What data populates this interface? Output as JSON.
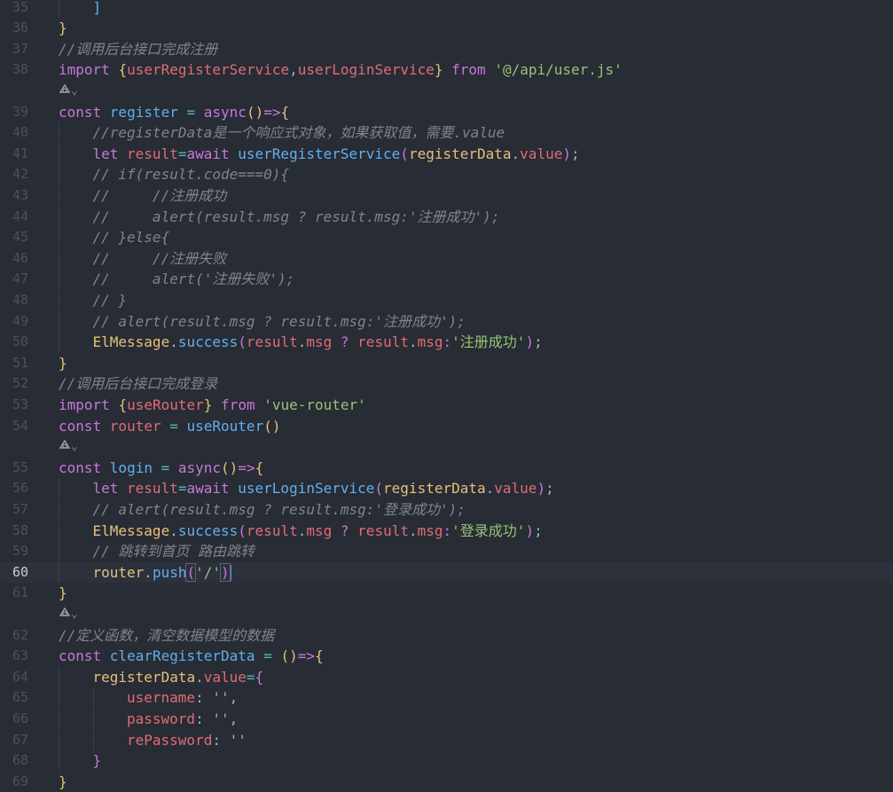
{
  "colors": {
    "background": "#282c34",
    "line_number": "#495162",
    "current_line_number": "#c8ccd4",
    "keyword": "#c678dd",
    "variable": "#e06c75",
    "function": "#61afef",
    "string": "#98c379",
    "comment": "#7f848e",
    "operator": "#56b6c2",
    "punctuation": "#abb2bf",
    "bracket_level1": "#e5c07b",
    "bracket_level2": "#c678dd",
    "bracket_level3": "#61afef"
  },
  "current_line": "60",
  "lines": [
    {
      "kind": "code",
      "num": "35",
      "indent": 1,
      "tokens": [
        {
          "t": "]",
          "c": "b3"
        }
      ]
    },
    {
      "kind": "code",
      "num": "36",
      "indent": 0,
      "tokens": [
        {
          "t": "}",
          "c": "b1"
        }
      ]
    },
    {
      "kind": "code",
      "num": "37",
      "indent": 0,
      "tokens": [
        {
          "t": "//调用后台接口完成注册",
          "c": "cm"
        }
      ]
    },
    {
      "kind": "code",
      "num": "38",
      "indent": 0,
      "tokens": [
        {
          "t": "import ",
          "c": "kw"
        },
        {
          "t": "{",
          "c": "b1"
        },
        {
          "t": "userRegisterService",
          "c": "var"
        },
        {
          "t": ",",
          "c": "pl"
        },
        {
          "t": "userLoginService",
          "c": "var"
        },
        {
          "t": "}",
          "c": "b1"
        },
        {
          "t": " from ",
          "c": "kw"
        },
        {
          "t": "'@/api/user.js'",
          "c": "str"
        }
      ]
    },
    {
      "kind": "lens",
      "icon": "codeium-lens-icon",
      "text": "⌄"
    },
    {
      "kind": "code",
      "num": "39",
      "indent": 0,
      "tokens": [
        {
          "t": "const ",
          "c": "kw"
        },
        {
          "t": "register",
          "c": "fn"
        },
        {
          "t": " = ",
          "c": "op"
        },
        {
          "t": "async",
          "c": "kw"
        },
        {
          "t": "()",
          "c": "b1"
        },
        {
          "t": "=>",
          "c": "kw"
        },
        {
          "t": "{",
          "c": "b1"
        }
      ]
    },
    {
      "kind": "code",
      "num": "40",
      "indent": 1,
      "tokens": [
        {
          "t": "//registerData是一个响应式对象，如果获取值，需要.value",
          "c": "cm"
        }
      ]
    },
    {
      "kind": "code",
      "num": "41",
      "indent": 1,
      "tokens": [
        {
          "t": "let ",
          "c": "kw"
        },
        {
          "t": "result",
          "c": "var"
        },
        {
          "t": "=",
          "c": "op"
        },
        {
          "t": "await ",
          "c": "kw"
        },
        {
          "t": "userRegisterService",
          "c": "fn"
        },
        {
          "t": "(",
          "c": "b2"
        },
        {
          "t": "registerData",
          "c": "obj"
        },
        {
          "t": ".",
          "c": "pl"
        },
        {
          "t": "value",
          "c": "var"
        },
        {
          "t": ")",
          "c": "b2"
        },
        {
          "t": ";",
          "c": "pl"
        }
      ]
    },
    {
      "kind": "code",
      "num": "42",
      "indent": 1,
      "tokens": [
        {
          "t": "// if(result.code===0){",
          "c": "cm"
        }
      ]
    },
    {
      "kind": "code",
      "num": "43",
      "indent": 1,
      "tokens": [
        {
          "t": "//     //注册成功",
          "c": "cm"
        }
      ]
    },
    {
      "kind": "code",
      "num": "44",
      "indent": 1,
      "tokens": [
        {
          "t": "//     alert(result.msg ? result.msg:'注册成功');",
          "c": "cm"
        }
      ]
    },
    {
      "kind": "code",
      "num": "45",
      "indent": 1,
      "tokens": [
        {
          "t": "// }else{",
          "c": "cm"
        }
      ]
    },
    {
      "kind": "code",
      "num": "46",
      "indent": 1,
      "tokens": [
        {
          "t": "//     //注册失败",
          "c": "cm"
        }
      ]
    },
    {
      "kind": "code",
      "num": "47",
      "indent": 1,
      "tokens": [
        {
          "t": "//     alert('注册失败');",
          "c": "cm"
        }
      ]
    },
    {
      "kind": "code",
      "num": "48",
      "indent": 1,
      "tokens": [
        {
          "t": "// }",
          "c": "cm"
        }
      ]
    },
    {
      "kind": "code",
      "num": "49",
      "indent": 1,
      "tokens": [
        {
          "t": "// alert(result.msg ? result.msg:'注册成功');",
          "c": "cm"
        }
      ]
    },
    {
      "kind": "code",
      "num": "50",
      "indent": 1,
      "tokens": [
        {
          "t": "ElMessage",
          "c": "obj"
        },
        {
          "t": ".",
          "c": "pl"
        },
        {
          "t": "success",
          "c": "fn"
        },
        {
          "t": "(",
          "c": "b2"
        },
        {
          "t": "result",
          "c": "var"
        },
        {
          "t": ".",
          "c": "pl"
        },
        {
          "t": "msg",
          "c": "var"
        },
        {
          "t": " ? ",
          "c": "kw"
        },
        {
          "t": "result",
          "c": "var"
        },
        {
          "t": ".",
          "c": "pl"
        },
        {
          "t": "msg",
          "c": "var"
        },
        {
          "t": ":",
          "c": "kw"
        },
        {
          "t": "'注册成功'",
          "c": "str"
        },
        {
          "t": ")",
          "c": "b2"
        },
        {
          "t": ";",
          "c": "pl"
        }
      ]
    },
    {
      "kind": "code",
      "num": "51",
      "indent": 0,
      "tokens": [
        {
          "t": "}",
          "c": "b1"
        }
      ]
    },
    {
      "kind": "code",
      "num": "52",
      "indent": 0,
      "tokens": [
        {
          "t": "//调用后台接口完成登录",
          "c": "cm"
        }
      ]
    },
    {
      "kind": "code",
      "num": "53",
      "indent": 0,
      "tokens": [
        {
          "t": "import ",
          "c": "kw"
        },
        {
          "t": "{",
          "c": "b1"
        },
        {
          "t": "useRouter",
          "c": "var"
        },
        {
          "t": "}",
          "c": "b1"
        },
        {
          "t": " from ",
          "c": "kw"
        },
        {
          "t": "'vue-router'",
          "c": "str"
        }
      ]
    },
    {
      "kind": "code",
      "num": "54",
      "indent": 0,
      "tokens": [
        {
          "t": "const ",
          "c": "kw"
        },
        {
          "t": "router",
          "c": "var"
        },
        {
          "t": " = ",
          "c": "op"
        },
        {
          "t": "useRouter",
          "c": "fn"
        },
        {
          "t": "()",
          "c": "b1"
        }
      ]
    },
    {
      "kind": "lens",
      "icon": "codeium-lens-icon",
      "text": "⌄"
    },
    {
      "kind": "code",
      "num": "55",
      "indent": 0,
      "tokens": [
        {
          "t": "const ",
          "c": "kw"
        },
        {
          "t": "login",
          "c": "fn"
        },
        {
          "t": " = ",
          "c": "op"
        },
        {
          "t": "async",
          "c": "kw"
        },
        {
          "t": "()",
          "c": "b1"
        },
        {
          "t": "=>",
          "c": "kw"
        },
        {
          "t": "{",
          "c": "b1"
        }
      ]
    },
    {
      "kind": "code",
      "num": "56",
      "indent": 1,
      "tokens": [
        {
          "t": "let ",
          "c": "kw"
        },
        {
          "t": "result",
          "c": "var"
        },
        {
          "t": "=",
          "c": "op"
        },
        {
          "t": "await ",
          "c": "kw"
        },
        {
          "t": "userLoginService",
          "c": "fn"
        },
        {
          "t": "(",
          "c": "b2"
        },
        {
          "t": "registerData",
          "c": "obj"
        },
        {
          "t": ".",
          "c": "pl"
        },
        {
          "t": "value",
          "c": "var"
        },
        {
          "t": ")",
          "c": "b2"
        },
        {
          "t": ";",
          "c": "pl"
        }
      ]
    },
    {
      "kind": "code",
      "num": "57",
      "indent": 1,
      "tokens": [
        {
          "t": "// alert(result.msg ? result.msg:'登录成功');",
          "c": "cm"
        }
      ]
    },
    {
      "kind": "code",
      "num": "58",
      "indent": 1,
      "tokens": [
        {
          "t": "ElMessage",
          "c": "obj"
        },
        {
          "t": ".",
          "c": "pl"
        },
        {
          "t": "success",
          "c": "fn"
        },
        {
          "t": "(",
          "c": "b2"
        },
        {
          "t": "result",
          "c": "var"
        },
        {
          "t": ".",
          "c": "pl"
        },
        {
          "t": "msg",
          "c": "var"
        },
        {
          "t": " ? ",
          "c": "kw"
        },
        {
          "t": "result",
          "c": "var"
        },
        {
          "t": ".",
          "c": "pl"
        },
        {
          "t": "msg",
          "c": "var"
        },
        {
          "t": ":",
          "c": "kw"
        },
        {
          "t": "'登录成功'",
          "c": "str"
        },
        {
          "t": ")",
          "c": "b2"
        },
        {
          "t": ";",
          "c": "pl"
        }
      ]
    },
    {
      "kind": "code",
      "num": "59",
      "indent": 1,
      "tokens": [
        {
          "t": "// 跳转到首页 路由跳转",
          "c": "cm"
        }
      ]
    },
    {
      "kind": "code",
      "num": "60",
      "indent": 1,
      "tokens": [
        {
          "t": "router",
          "c": "obj"
        },
        {
          "t": ".",
          "c": "pl"
        },
        {
          "t": "push",
          "c": "fn"
        },
        {
          "t": "(",
          "c": "b2m"
        },
        {
          "t": "'/'",
          "c": "str"
        },
        {
          "t": ")",
          "c": "b2m"
        },
        {
          "t": "",
          "c": "caret"
        }
      ]
    },
    {
      "kind": "code",
      "num": "61",
      "indent": 0,
      "tokens": [
        {
          "t": "}",
          "c": "b1"
        }
      ]
    },
    {
      "kind": "lens",
      "icon": "codeium-lens-icon",
      "text": "⌄"
    },
    {
      "kind": "code",
      "num": "62",
      "indent": 0,
      "tokens": [
        {
          "t": "//定义函数，清空数据模型的数据",
          "c": "cm"
        }
      ]
    },
    {
      "kind": "code",
      "num": "63",
      "indent": 0,
      "tokens": [
        {
          "t": "const ",
          "c": "kw"
        },
        {
          "t": "clearRegisterData",
          "c": "fn"
        },
        {
          "t": " = ",
          "c": "op"
        },
        {
          "t": "()",
          "c": "b1"
        },
        {
          "t": "=>",
          "c": "kw"
        },
        {
          "t": "{",
          "c": "b1"
        }
      ]
    },
    {
      "kind": "code",
      "num": "64",
      "indent": 1,
      "tokens": [
        {
          "t": "registerData",
          "c": "obj"
        },
        {
          "t": ".",
          "c": "pl"
        },
        {
          "t": "value",
          "c": "var"
        },
        {
          "t": "=",
          "c": "op"
        },
        {
          "t": "{",
          "c": "b2"
        }
      ]
    },
    {
      "kind": "code",
      "num": "65",
      "indent": 2,
      "tokens": [
        {
          "t": "username",
          "c": "var"
        },
        {
          "t": ": ",
          "c": "pl"
        },
        {
          "t": "''",
          "c": "str"
        },
        {
          "t": ",",
          "c": "pl"
        }
      ]
    },
    {
      "kind": "code",
      "num": "66",
      "indent": 2,
      "tokens": [
        {
          "t": "password",
          "c": "var"
        },
        {
          "t": ": ",
          "c": "pl"
        },
        {
          "t": "''",
          "c": "str"
        },
        {
          "t": ",",
          "c": "pl"
        }
      ]
    },
    {
      "kind": "code",
      "num": "67",
      "indent": 2,
      "tokens": [
        {
          "t": "rePassword",
          "c": "var"
        },
        {
          "t": ": ",
          "c": "pl"
        },
        {
          "t": "''",
          "c": "str"
        }
      ]
    },
    {
      "kind": "code",
      "num": "68",
      "indent": 1,
      "tokens": [
        {
          "t": "}",
          "c": "b2"
        }
      ]
    },
    {
      "kind": "code",
      "num": "69",
      "indent": 0,
      "tokens": [
        {
          "t": "}",
          "c": "b1"
        }
      ]
    }
  ]
}
